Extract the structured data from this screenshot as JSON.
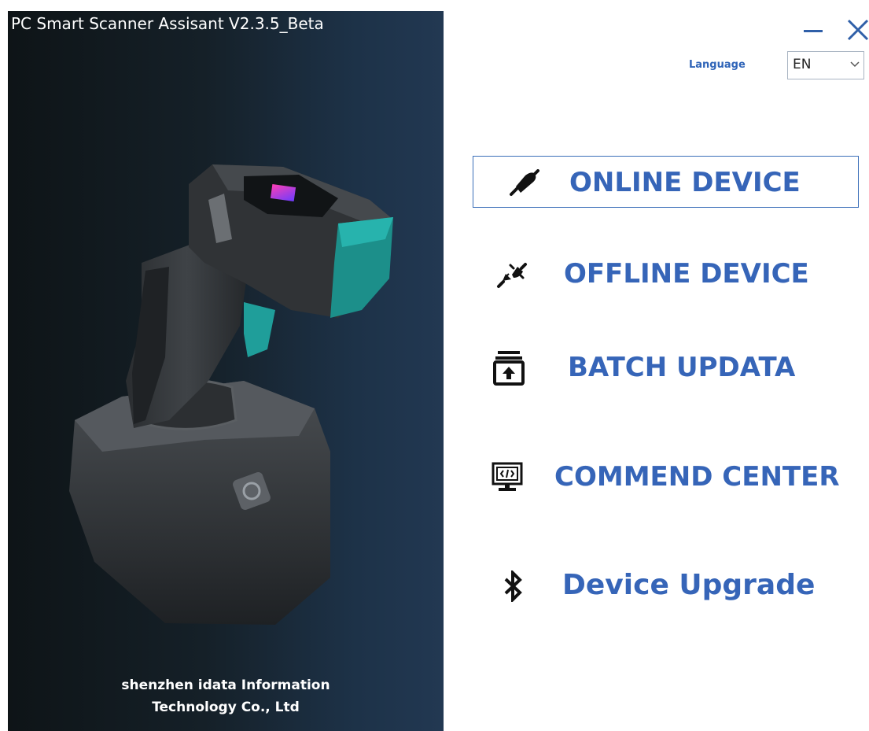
{
  "window": {
    "title": "PC Smart Scanner Assisant V2.3.5_Beta",
    "minimize_icon": "minimize-icon",
    "close_icon": "close-icon"
  },
  "banner": {
    "company_line1": "shenzhen idata Information",
    "company_line2": "Technology Co., Ltd",
    "image": "barcode-scanner-on-cradle"
  },
  "language": {
    "label": "Language",
    "selected": "EN"
  },
  "menu": {
    "items": [
      {
        "label": "ONLINE DEVICE",
        "icon": "plug-connected-icon",
        "selected": true
      },
      {
        "label": "OFFLINE DEVICE",
        "icon": "plug-disconnected-icon",
        "selected": false
      },
      {
        "label": "BATCH UPDATA",
        "icon": "upload-box-icon",
        "selected": false
      },
      {
        "label": "COMMEND CENTER",
        "icon": "monitor-code-icon",
        "selected": false
      },
      {
        "label": "Device Upgrade",
        "icon": "bluetooth-icon",
        "selected": false
      }
    ]
  },
  "colors": {
    "accent": "#3665b8",
    "banner_dark": "#0e1417",
    "banner_blue": "#223852",
    "selected_border": "#3b6fb9"
  }
}
